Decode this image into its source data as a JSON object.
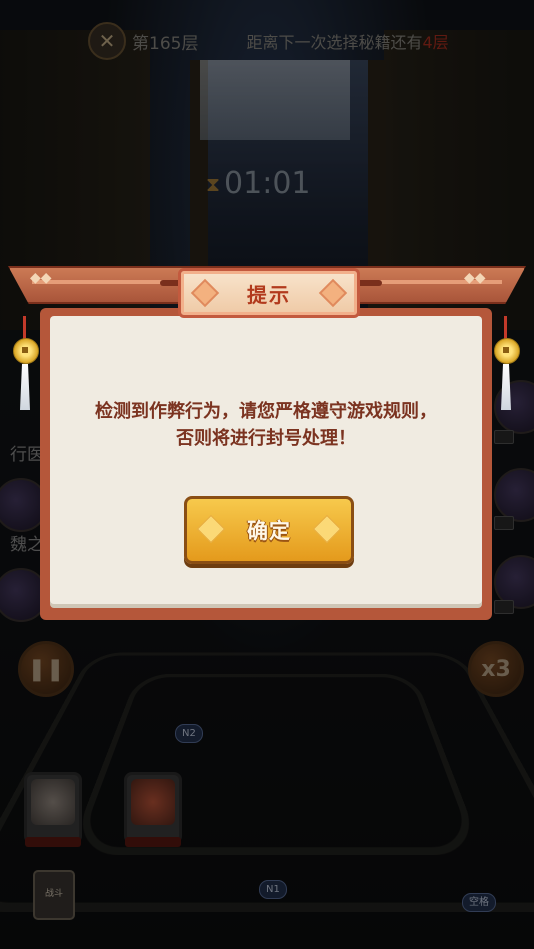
{
  "hud": {
    "level": "第165层",
    "next_choice_prefix": "距离下一次选择秘籍还有",
    "next_choice_count": "4层",
    "timer": "01:01",
    "side_labels": [
      "行医",
      "魏之"
    ],
    "speed_label": "x3",
    "pause_icon": "pause-icon"
  },
  "map": {
    "nodes": [
      "N2",
      "N1"
    ],
    "hotkey_hint": "空格",
    "hero_small_label": "战斗"
  },
  "dialog": {
    "title": "提示",
    "message_lines": [
      "检测到作弊行为，请您严格遵守游戏规则，",
      "否则将进行封号处理！"
    ],
    "confirm_label": "确定"
  },
  "colors": {
    "dialog_frame": "#b5573a",
    "dialog_body": "#f0ebe1",
    "message_text": "#7b3320",
    "button_gold": "#f0b030",
    "highlight_red": "#b03020"
  }
}
